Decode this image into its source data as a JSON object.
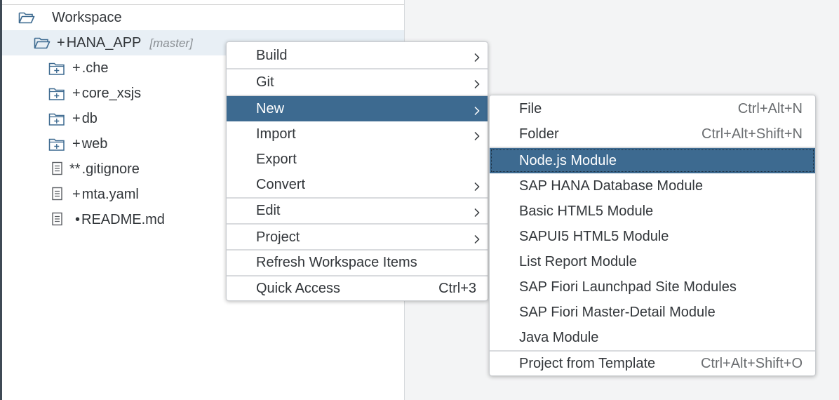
{
  "workspace": {
    "root_label": "Workspace",
    "project": {
      "prefix": "+",
      "name": "HANA_APP",
      "branch": "[master]"
    },
    "children": [
      {
        "prefix": "+",
        "name": ".che",
        "type": "folder"
      },
      {
        "prefix": "+",
        "name": "core_xsjs",
        "type": "folder"
      },
      {
        "prefix": "+",
        "name": "db",
        "type": "folder"
      },
      {
        "prefix": "+",
        "name": "web",
        "type": "folder"
      },
      {
        "prefix": "**",
        "name": ".gitignore",
        "type": "file"
      },
      {
        "prefix": "+",
        "name": "mta.yaml",
        "type": "file"
      },
      {
        "prefix": "•",
        "name": "README.md",
        "type": "file"
      }
    ]
  },
  "context_menu": {
    "items": [
      {
        "label": "Build",
        "submenu": true
      },
      {
        "label": "Git",
        "submenu": true
      },
      {
        "label": "New",
        "submenu": true,
        "active": true
      },
      {
        "label": "Import",
        "submenu": true
      },
      {
        "label": "Export",
        "submenu": false
      },
      {
        "label": "Convert",
        "submenu": true
      },
      {
        "label": "Edit",
        "submenu": true
      },
      {
        "label": "Project",
        "submenu": true
      },
      {
        "label": "Refresh Workspace Items",
        "submenu": false
      },
      {
        "label": "Quick Access",
        "shortcut": "Ctrl+3",
        "submenu": false
      }
    ]
  },
  "new_submenu": {
    "items": [
      {
        "label": "File",
        "shortcut": "Ctrl+Alt+N"
      },
      {
        "label": "Folder",
        "shortcut": "Ctrl+Alt+Shift+N"
      },
      {
        "label": "Node.js Module",
        "focused": true
      },
      {
        "label": "SAP HANA Database Module"
      },
      {
        "label": "Basic HTML5 Module"
      },
      {
        "label": "SAPUI5 HTML5 Module"
      },
      {
        "label": "List Report Module"
      },
      {
        "label": "SAP Fiori Launchpad Site Modules"
      },
      {
        "label": "SAP Fiori Master-Detail Module"
      },
      {
        "label": "Java Module"
      },
      {
        "label": "Project from Template",
        "shortcut": "Ctrl+Alt+Shift+O"
      }
    ]
  },
  "colors": {
    "highlight": "#3d6a90",
    "selected_row": "#e8eff5",
    "text": "#32363a",
    "muted": "#8a8f94",
    "icon": "#3d6a90",
    "side_bar": "#3f4a55"
  }
}
